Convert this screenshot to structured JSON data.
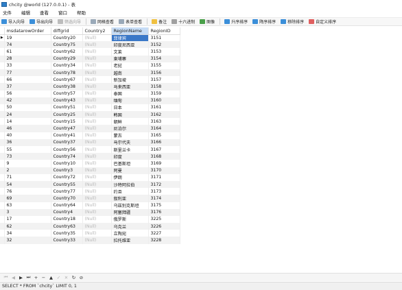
{
  "window": {
    "title": "chcity @world (127.0.0.1) - 表"
  },
  "menu": [
    "文件",
    "编辑",
    "查看",
    "窗口",
    "帮助"
  ],
  "toolbar": {
    "import_wizard": "导入向导",
    "export_wizard": "导出向导",
    "filter_wizard": "筛选向导",
    "grid_view": "网格查看",
    "form_view": "表单查看",
    "memo": "备注",
    "hex": "十六进制",
    "image": "图像",
    "sort_asc": "升序排序",
    "sort_desc": "降序排序",
    "remove_sort": "移除排序",
    "custom_sort": "自定义排序"
  },
  "table": {
    "columns": [
      "msdatarowOrder",
      "diffgrid",
      "Country2",
      "RegionName",
      "RegionID"
    ],
    "null_text": "(Null)",
    "rows": [
      [
        "19",
        "Country20",
        "(Null)",
        "菲律宾",
        "3151"
      ],
      [
        "74",
        "Country75",
        "(Null)",
        "印度尼西亚",
        "3152"
      ],
      [
        "61",
        "Country62",
        "(Null)",
        "文莱",
        "3153"
      ],
      [
        "28",
        "Country29",
        "(Null)",
        "柬埔寨",
        "3154"
      ],
      [
        "33",
        "Country34",
        "(Null)",
        "老挝",
        "3155"
      ],
      [
        "77",
        "Country78",
        "(Null)",
        "越南",
        "3156"
      ],
      [
        "66",
        "Country67",
        "(Null)",
        "新加坡",
        "3157"
      ],
      [
        "37",
        "Country38",
        "(Null)",
        "马来西亚",
        "3158"
      ],
      [
        "56",
        "Country57",
        "(Null)",
        "泰国",
        "3159"
      ],
      [
        "42",
        "Country43",
        "(Null)",
        "缅甸",
        "3160"
      ],
      [
        "50",
        "Country51",
        "(Null)",
        "日本",
        "3161"
      ],
      [
        "24",
        "Country25",
        "(Null)",
        "韩国",
        "3162"
      ],
      [
        "14",
        "Country15",
        "(Null)",
        "朝鲜",
        "3163"
      ],
      [
        "46",
        "Country47",
        "(Null)",
        "尼泊尔",
        "3164"
      ],
      [
        "40",
        "Country41",
        "(Null)",
        "蒙古",
        "3165"
      ],
      [
        "36",
        "Country37",
        "(Null)",
        "马尔代夫",
        "3166"
      ],
      [
        "55",
        "Country56",
        "(Null)",
        "斯里兰卡",
        "3167"
      ],
      [
        "73",
        "Country74",
        "(Null)",
        "印度",
        "3168"
      ],
      [
        "9",
        "Country10",
        "(Null)",
        "巴基斯坦",
        "3169"
      ],
      [
        "2",
        "Country3",
        "(Null)",
        "阿曼",
        "3170"
      ],
      [
        "71",
        "Country72",
        "(Null)",
        "伊朗",
        "3171"
      ],
      [
        "54",
        "Country55",
        "(Null)",
        "沙特阿拉伯",
        "3172"
      ],
      [
        "76",
        "Country77",
        "(Null)",
        "约旦",
        "3173"
      ],
      [
        "69",
        "Country70",
        "(Null)",
        "叙利亚",
        "3174"
      ],
      [
        "63",
        "Country64",
        "(Null)",
        "乌兹别克斯坦",
        "3175"
      ],
      [
        "3",
        "Country4",
        "(Null)",
        "阿塞拜疆",
        "3176"
      ],
      [
        "17",
        "Country18",
        "(Null)",
        "俄罗斯",
        "3225"
      ],
      [
        "62",
        "Country63",
        "(Null)",
        "乌克兰",
        "3226"
      ],
      [
        "34",
        "Country35",
        "(Null)",
        "立陶宛",
        "3227"
      ],
      [
        "32",
        "Country33",
        "(Null)",
        "拉托维亚",
        "3228"
      ]
    ]
  },
  "navigation": [
    "⏮",
    "◀",
    "▶",
    "⏭",
    "+",
    "−",
    "▲",
    "✓",
    "✕",
    "↻",
    "⊘"
  ],
  "status": {
    "sql": "SELECT * FROM `chcity` LIMIT 0, 1"
  },
  "colors": {
    "selected_cell": "#3a78c8",
    "selected_header": "#c6dcf5",
    "null_text": "#b5b5b5"
  }
}
